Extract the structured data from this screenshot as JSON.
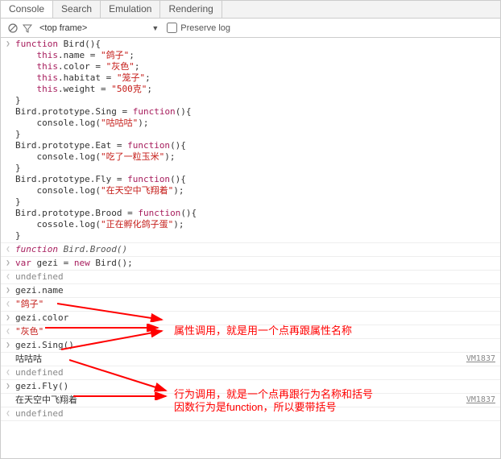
{
  "tabs": {
    "console": "Console",
    "search": "Search",
    "emulation": "Emulation",
    "rendering": "Rendering"
  },
  "toolbar": {
    "frame": "<top frame>",
    "preserve": "Preserve log"
  },
  "code_block": {
    "l1": "function Bird(){",
    "l2": "    this.name = \"鸽子\";",
    "l3": "    this.color = \"灰色\";",
    "l4": "    this.habitat = \"笼子\";",
    "l5": "    this.weight = \"500克\";",
    "l6": "}",
    "l7": "Bird.prototype.Sing = function(){",
    "l8": "    console.log(\"咕咕咕\");",
    "l9": "}",
    "l10": "Bird.prototype.Eat = function(){",
    "l11": "    console.log(\"吃了一粒玉米\");",
    "l12": "}",
    "l13": "Bird.prototype.Fly = function(){",
    "l14": "    console.log(\"在天空中飞翔着\");",
    "l15": "}",
    "l16": "Bird.prototype.Brood = function(){",
    "l17": "    cossole.log(\"正在孵化鸽子蛋\");",
    "l18": "}"
  },
  "out1": "function Bird.Brood()",
  "in2": "var gezi = new Bird();",
  "out2": "undefined",
  "in3": "gezi.name",
  "out3": "\"鸽子\"",
  "in4": "gezi.color",
  "out4": "\"灰色\"",
  "in5": "gezi.Sing()",
  "log5": "咕咕咕",
  "out5": "undefined",
  "in6": "gezi.Fly()",
  "log6": "在天空中飞翔着",
  "out6": "undefined",
  "vmlink": "VM1837",
  "annot1": "属性调用，就是用一个点再跟属性名称",
  "annot2_l1": "行为调用，就是一个点再跟行为名称和括号",
  "annot2_l2": "因数行为是function，所以要带括号"
}
